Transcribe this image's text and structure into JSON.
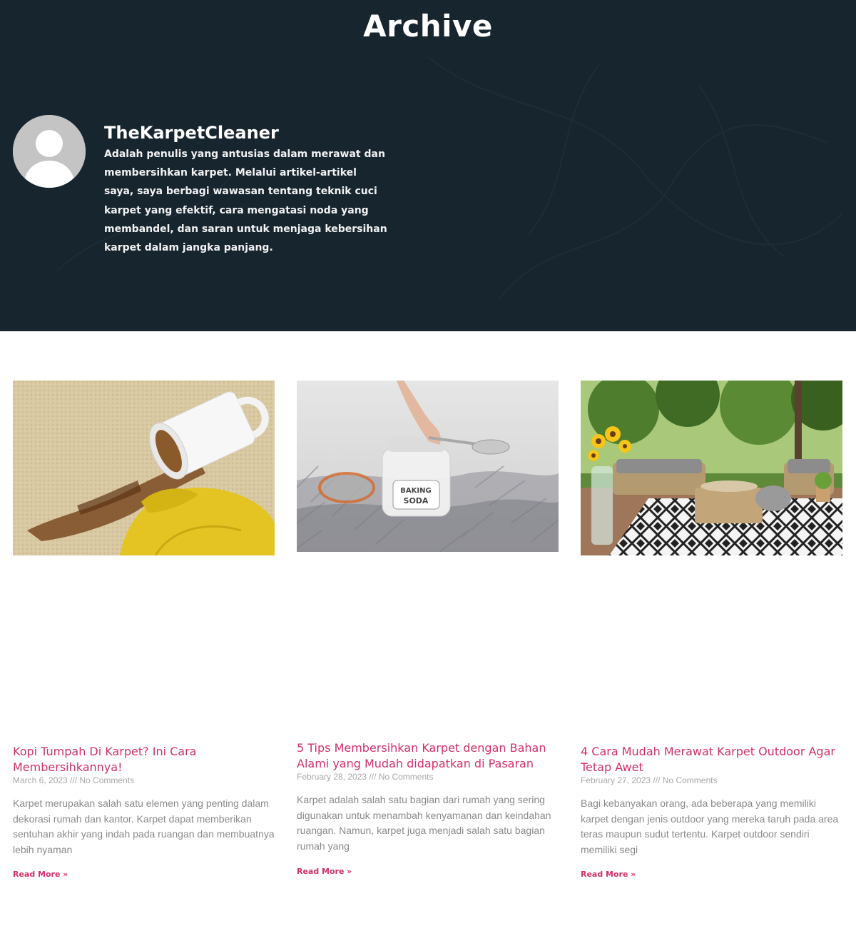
{
  "page": {
    "title": "Archive"
  },
  "author": {
    "name": "TheKarpetCleaner",
    "bio": "Adalah penulis yang antusias dalam merawat dan membersihkan karpet. Melalui artikel-artikel saya, saya berbagi wawasan tentang teknik cuci karpet yang efektif, cara mengatasi noda yang membandel, dan saran untuk menjaga kebersihan karpet dalam jangka panjang.",
    "avatar_icon": "user-silhouette-icon"
  },
  "posts": [
    {
      "title": "Kopi Tumpah Di Karpet? Ini Cara Membersihkannya!",
      "date": "March 6, 2023",
      "separator": "///",
      "comments": "No Comments",
      "excerpt": "Karpet merupakan salah satu elemen yang penting dalam dekorasi rumah dan kantor. Karpet dapat memberikan sentuhan akhir yang indah pada ruangan dan membuatnya lebih nyaman",
      "read_more": "Read More »"
    },
    {
      "title": "5 Tips Membersihkan Karpet dengan Bahan Alami yang Mudah didapatkan di Pasaran",
      "date": "February 28, 2023",
      "separator": "///",
      "comments": "No Comments",
      "excerpt": "Karpet adalah salah satu bagian dari rumah yang sering digunakan untuk menambah kenyamanan dan keindahan ruangan. Namun, karpet juga menjadi salah satu bagian rumah yang",
      "read_more": "Read More »",
      "image_label_1": "BAKING",
      "image_label_2": "SODA"
    },
    {
      "title": "4 Cara Mudah Merawat Karpet Outdoor Agar Tetap Awet",
      "date": "February 27, 2023",
      "separator": "///",
      "comments": "No Comments",
      "excerpt": "Bagi kebanyakan orang, ada beberapa yang memiliki karpet dengan jenis outdoor yang mereka taruh pada area teras maupun sudut tertentu. Karpet outdoor sendiri memiliki segi",
      "read_more": "Read More »"
    }
  ],
  "colors": {
    "hero_bg": "#17252f",
    "accent": "#d3306a",
    "meta": "#a8a8a8",
    "excerpt": "#8a8a8a"
  }
}
